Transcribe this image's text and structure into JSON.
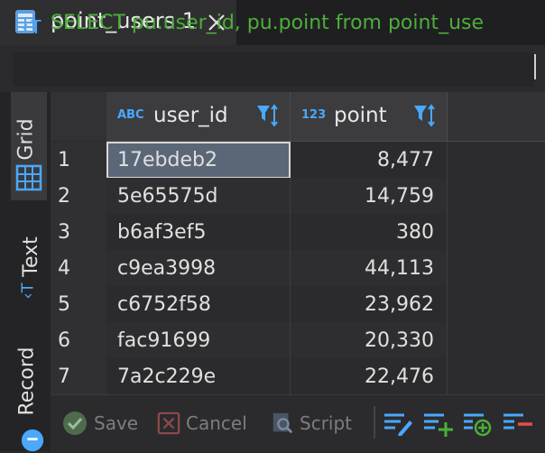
{
  "tab": {
    "title": "point_users 1"
  },
  "query": {
    "text": "SELECT pu.user_id, pu.point from point_use"
  },
  "side_tabs": {
    "grid": "Grid",
    "text": "Text",
    "record": "Record"
  },
  "columns": [
    {
      "type_badge": "ABC",
      "name": "user_id"
    },
    {
      "type_badge": "123",
      "name": "point"
    }
  ],
  "rows": [
    {
      "num": "1",
      "user_id": "17ebdeb2",
      "point": "8,477"
    },
    {
      "num": "2",
      "user_id": "5e65575d",
      "point": "14,759"
    },
    {
      "num": "3",
      "user_id": "b6af3ef5",
      "point": "380"
    },
    {
      "num": "4",
      "user_id": "c9ea3998",
      "point": "44,113"
    },
    {
      "num": "5",
      "user_id": "c6752f58",
      "point": "23,962"
    },
    {
      "num": "6",
      "user_id": "fac91699",
      "point": "20,330"
    },
    {
      "num": "7",
      "user_id": "7a2c229e",
      "point": "22,476"
    }
  ],
  "toolbar": {
    "save": "Save",
    "cancel": "Cancel",
    "script": "Script"
  },
  "colors": {
    "accent": "#4aa8ff",
    "query": "#4caf3a",
    "selection": "#5b6777"
  }
}
